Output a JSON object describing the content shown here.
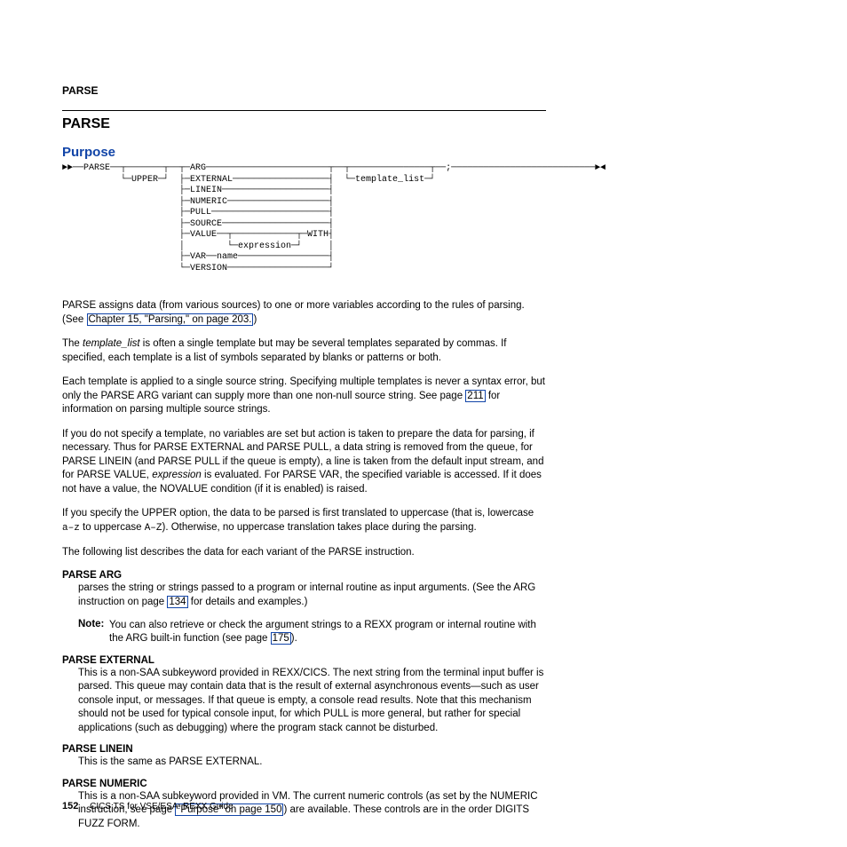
{
  "header": {
    "label": "PARSE"
  },
  "title": "PARSE",
  "subtitle": "Purpose",
  "diagram": "►►──PARSE──┬───────┬──┬─ARG───────────────────────┬──┬───────────────┬──;───────────────────────────►◄\n           └─UPPER─┘  ├─EXTERNAL──────────────────┤  └─template_list─┘\n                      ├─LINEIN────────────────────┤\n                      ├─NUMERIC───────────────────┤\n                      ├─PULL──────────────────────┤\n                      ├─SOURCE────────────────────┤\n                      ├─VALUE──┬────────────┬─WITH┤\n                      │        └─expression─┘     │\n                      ├─VAR──name─────────────────┤\n                      └─VERSION───────────────────┘",
  "p1_a": "PARSE assigns data (from various sources) to one or more variables according to the rules of parsing. (See ",
  "p1_link": "Chapter 15, \"Parsing,\" on page 203.",
  "p1_b": ")",
  "p2_a": "The ",
  "p2_i": "template_list",
  "p2_b": " is often a single template but may be several templates separated by commas. If specified, each template is a list of symbols separated by blanks or patterns or both.",
  "p3_a": "Each template is applied to a single source string. Specifying multiple templates is never a syntax error, but only the PARSE ARG variant can supply more than one non-null source string. See page ",
  "p3_link": "211",
  "p3_b": " for information on parsing multiple source strings.",
  "p4_a": "If you do not specify a template, no variables are set but action is taken to prepare the data for parsing, if necessary. Thus for PARSE EXTERNAL and PARSE PULL, a data string is removed from the queue, for PARSE LINEIN (and PARSE PULL if the queue is empty), a line is taken from the default input stream, and for PARSE VALUE, ",
  "p4_i": "expression",
  "p4_b": " is evaluated. For PARSE VAR, the specified variable is accessed. If it does not have a value, the NOVALUE condition (if it is enabled) is raised.",
  "p5_a": "If you specify the UPPER option, the data to be parsed is first translated to uppercase (that is, lowercase ",
  "p5_m1": "a–z",
  "p5_b": " to uppercase ",
  "p5_m2": "A–Z",
  "p5_c": "). Otherwise, no uppercase translation takes place during the parsing.",
  "p6": "The following list describes the data for each variant of the PARSE instruction.",
  "dl": {
    "arg": {
      "term": "PARSE ARG",
      "def_a": "parses the string or strings passed to a program or internal routine as input arguments. (See the ARG instruction on page ",
      "def_link": "134",
      "def_b": " for details and examples.)",
      "note_label": "Note:",
      "note_a": "You can also retrieve or check the argument strings to a REXX program or internal routine with the ARG built-in function (see page ",
      "note_link": "175",
      "note_b": ")."
    },
    "ext": {
      "term": "PARSE EXTERNAL",
      "def": "This is a non-SAA subkeyword provided in REXX/CICS. The next string from the terminal input buffer is parsed. This queue may contain data that is the result of external asynchronous events—such as user console input, or messages. If that queue is empty, a console read results. Note that this mechanism should not be used for typical console input, for which PULL is more general, but rather for special applications (such as debugging) where the program stack cannot be disturbed."
    },
    "lin": {
      "term": "PARSE LINEIN",
      "def": "This is the same as PARSE EXTERNAL."
    },
    "num": {
      "term": "PARSE NUMERIC",
      "def_a": "This is a non-SAA subkeyword provided in VM. The current numeric controls (as set by the NUMERIC instruction, see page ",
      "def_link": "\"Purpose\" on page 150",
      "def_b": ") are available. These controls are in the order DIGITS FUZZ FORM."
    }
  },
  "footer": {
    "page": "152",
    "text": "CICS TS for VSE/ESA: REXX Guide"
  }
}
